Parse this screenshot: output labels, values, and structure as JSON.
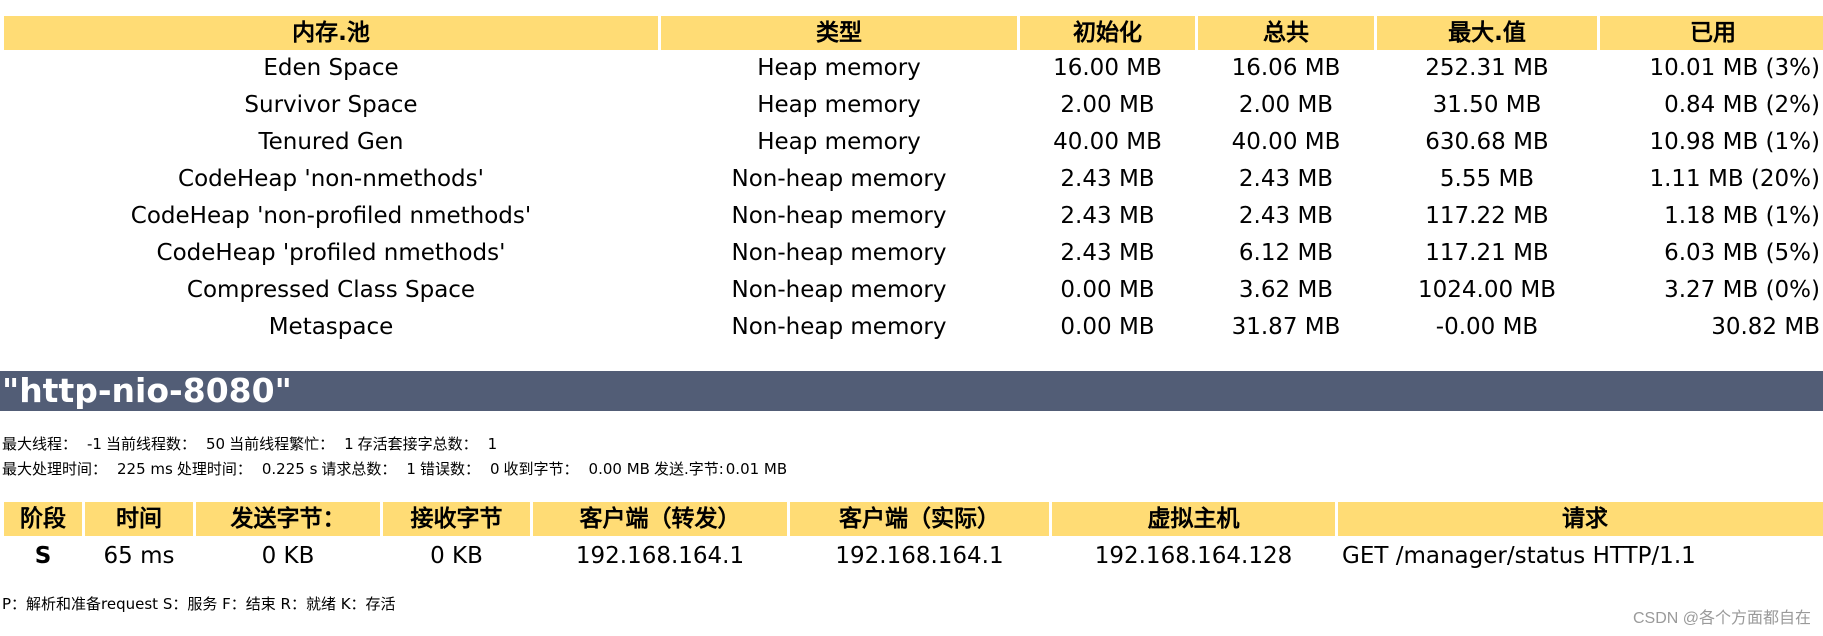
{
  "memory_pools": {
    "headers": [
      "内存.池",
      "类型",
      "初始化",
      "总共",
      "最大.值",
      "已用"
    ],
    "rows": [
      [
        "Eden Space",
        "Heap memory",
        "16.00 MB",
        "16.06 MB",
        "252.31 MB",
        "10.01 MB (3%)"
      ],
      [
        "Survivor Space",
        "Heap memory",
        "2.00 MB",
        "2.00 MB",
        "31.50 MB",
        "0.84 MB (2%)"
      ],
      [
        "Tenured Gen",
        "Heap memory",
        "40.00 MB",
        "40.00 MB",
        "630.68 MB",
        "10.98 MB (1%)"
      ],
      [
        "CodeHeap 'non-nmethods'",
        "Non-heap memory",
        "2.43 MB",
        "2.43 MB",
        "5.55 MB",
        "1.11 MB (20%)"
      ],
      [
        "CodeHeap 'non-profiled nmethods'",
        "Non-heap memory",
        "2.43 MB",
        "2.43 MB",
        "117.22 MB",
        "1.18 MB (1%)"
      ],
      [
        "CodeHeap 'profiled nmethods'",
        "Non-heap memory",
        "2.43 MB",
        "6.12 MB",
        "117.21 MB",
        "6.03 MB (5%)"
      ],
      [
        "Compressed Class Space",
        "Non-heap memory",
        "0.00 MB",
        "3.62 MB",
        "1024.00 MB",
        "3.27 MB (0%)"
      ],
      [
        "Metaspace",
        "Non-heap memory",
        "0.00 MB",
        "31.87 MB",
        "-0.00 MB",
        "30.82 MB"
      ]
    ]
  },
  "connector": {
    "name": "\"http-nio-8080\"",
    "thread_stats": [
      {
        "label": "最大线程：",
        "value": "-1"
      },
      {
        "label": "当前线程数：",
        "value": "50"
      },
      {
        "label": "当前线程繁忙：",
        "value": "1"
      },
      {
        "label": "存活套接字总数：",
        "value": "1"
      }
    ],
    "request_stats": [
      {
        "label": "最大处理时间：",
        "value": "225 ms"
      },
      {
        "label": "处理时间：",
        "value": "0.225 s"
      },
      {
        "label": "请求总数：",
        "value": "1"
      },
      {
        "label": "错误数：",
        "value": "0"
      },
      {
        "label": "收到字节：",
        "value": "0.00 MB"
      },
      {
        "label": "发送.字节:",
        "value": "0.01 MB"
      }
    ]
  },
  "workers": {
    "headers": [
      "阶段",
      "时间",
      "发送字节：",
      "接收字节",
      "客户端（转发）",
      "客户端（实际）",
      "虚拟主机",
      "请求"
    ],
    "rows": [
      [
        "S",
        "65 ms",
        "0 KB",
        "0 KB",
        "192.168.164.1",
        "192.168.164.1",
        "192.168.164.128",
        "GET /manager/status HTTP/1.1"
      ]
    ]
  },
  "legend": "P：解析和准备request S：服务 F：结束 R：就绪 K：存活",
  "watermark": "CSDN @各个方面都自在"
}
